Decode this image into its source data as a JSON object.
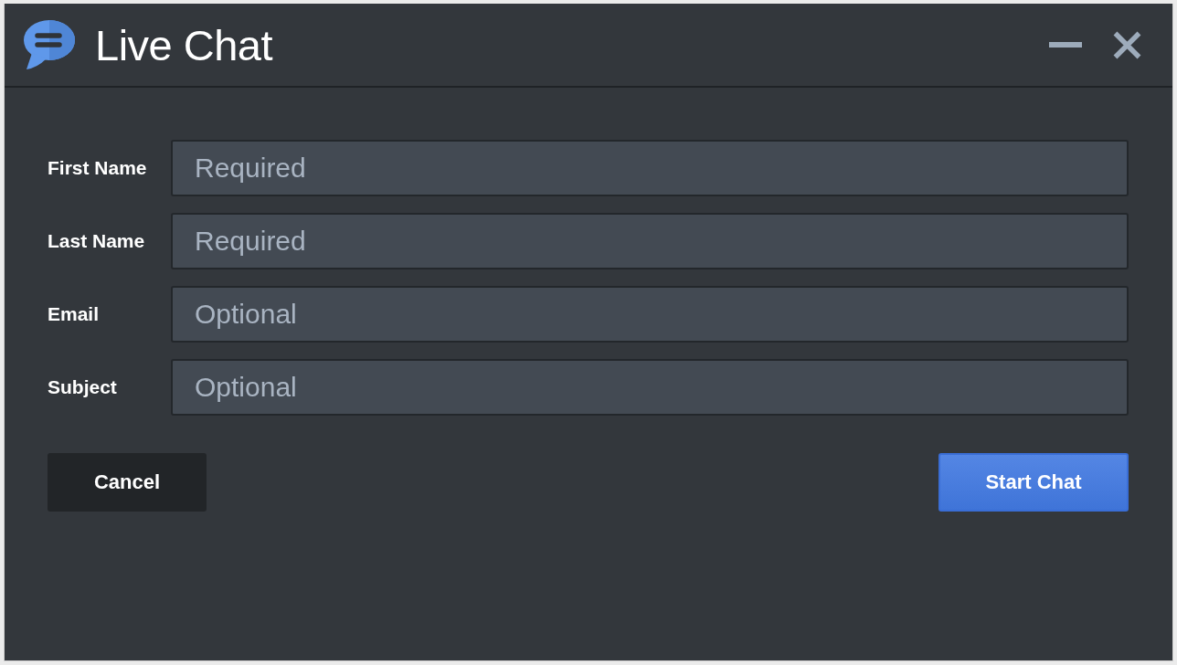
{
  "window": {
    "title": "Live Chat"
  },
  "fields": [
    {
      "label": "First Name",
      "placeholder": "Required"
    },
    {
      "label": "Last Name",
      "placeholder": "Required"
    },
    {
      "label": "Email",
      "placeholder": "Optional"
    },
    {
      "label": "Subject",
      "placeholder": "Optional"
    }
  ],
  "buttons": [
    {
      "label": "Cancel",
      "kind": "secondary"
    },
    {
      "label": "Start Chat",
      "kind": "primary"
    }
  ]
}
